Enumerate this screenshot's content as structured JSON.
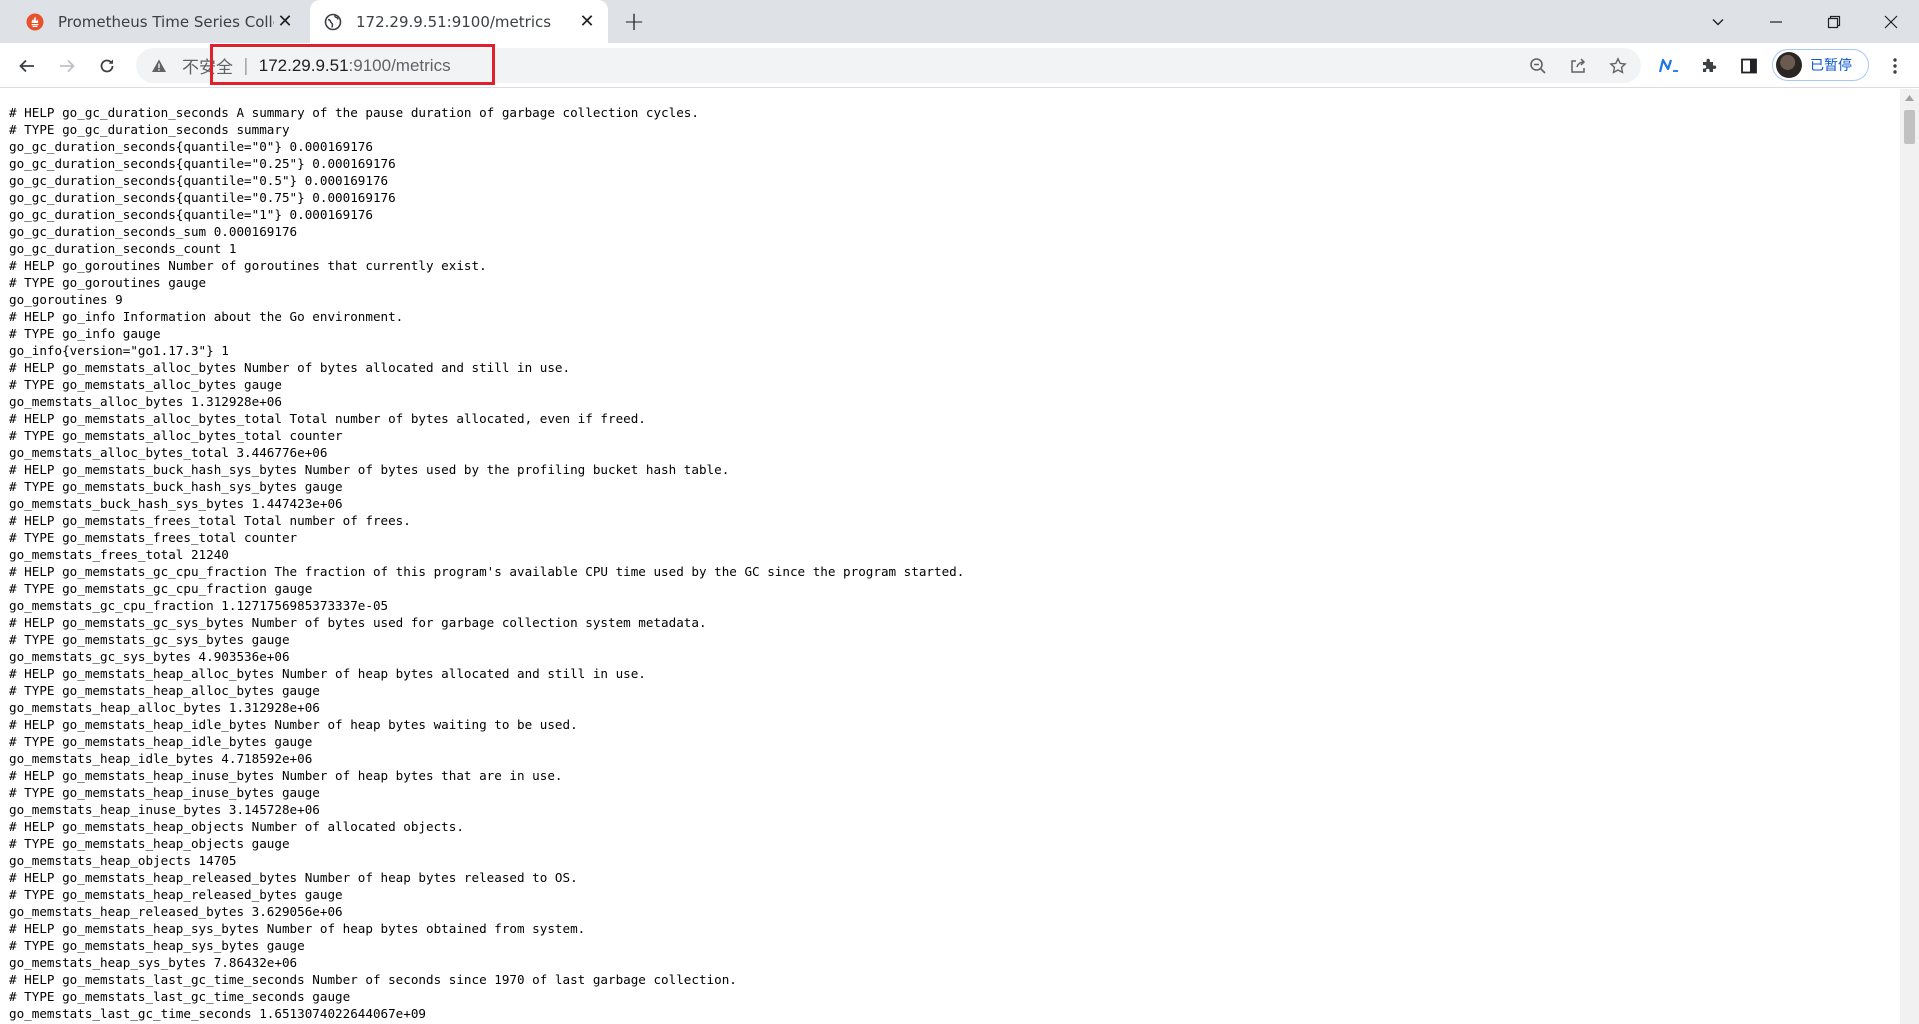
{
  "tabs": [
    {
      "title": "Prometheus Time Series Collection",
      "favicon": "prometheus-icon",
      "active": false
    },
    {
      "title": "172.29.9.51:9100/metrics",
      "favicon": "globe-icon",
      "active": true
    }
  ],
  "toolbar": {
    "security_label": "不安全",
    "separator": "|",
    "url_host": "172.29.9.51",
    "url_rest": ":9100/metrics",
    "profile_label": "已暂停"
  },
  "icons": {
    "back": "back-arrow-icon",
    "forward": "forward-arrow-icon",
    "reload": "reload-icon",
    "zoom": "zoom-out-icon",
    "share": "share-icon",
    "bookmark": "star-icon",
    "extension_n": "extension-n-icon",
    "extensions": "puzzle-icon",
    "side_panel": "side-panel-icon",
    "menu": "kebab-menu-icon"
  },
  "metrics_lines": [
    "# HELP go_gc_duration_seconds A summary of the pause duration of garbage collection cycles.",
    "# TYPE go_gc_duration_seconds summary",
    "go_gc_duration_seconds{quantile=\"0\"} 0.000169176",
    "go_gc_duration_seconds{quantile=\"0.25\"} 0.000169176",
    "go_gc_duration_seconds{quantile=\"0.5\"} 0.000169176",
    "go_gc_duration_seconds{quantile=\"0.75\"} 0.000169176",
    "go_gc_duration_seconds{quantile=\"1\"} 0.000169176",
    "go_gc_duration_seconds_sum 0.000169176",
    "go_gc_duration_seconds_count 1",
    "# HELP go_goroutines Number of goroutines that currently exist.",
    "# TYPE go_goroutines gauge",
    "go_goroutines 9",
    "# HELP go_info Information about the Go environment.",
    "# TYPE go_info gauge",
    "go_info{version=\"go1.17.3\"} 1",
    "# HELP go_memstats_alloc_bytes Number of bytes allocated and still in use.",
    "# TYPE go_memstats_alloc_bytes gauge",
    "go_memstats_alloc_bytes 1.312928e+06",
    "# HELP go_memstats_alloc_bytes_total Total number of bytes allocated, even if freed.",
    "# TYPE go_memstats_alloc_bytes_total counter",
    "go_memstats_alloc_bytes_total 3.446776e+06",
    "# HELP go_memstats_buck_hash_sys_bytes Number of bytes used by the profiling bucket hash table.",
    "# TYPE go_memstats_buck_hash_sys_bytes gauge",
    "go_memstats_buck_hash_sys_bytes 1.447423e+06",
    "# HELP go_memstats_frees_total Total number of frees.",
    "# TYPE go_memstats_frees_total counter",
    "go_memstats_frees_total 21240",
    "# HELP go_memstats_gc_cpu_fraction The fraction of this program's available CPU time used by the GC since the program started.",
    "# TYPE go_memstats_gc_cpu_fraction gauge",
    "go_memstats_gc_cpu_fraction 1.1271756985373337e-05",
    "# HELP go_memstats_gc_sys_bytes Number of bytes used for garbage collection system metadata.",
    "# TYPE go_memstats_gc_sys_bytes gauge",
    "go_memstats_gc_sys_bytes 4.903536e+06",
    "# HELP go_memstats_heap_alloc_bytes Number of heap bytes allocated and still in use.",
    "# TYPE go_memstats_heap_alloc_bytes gauge",
    "go_memstats_heap_alloc_bytes 1.312928e+06",
    "# HELP go_memstats_heap_idle_bytes Number of heap bytes waiting to be used.",
    "# TYPE go_memstats_heap_idle_bytes gauge",
    "go_memstats_heap_idle_bytes 4.718592e+06",
    "# HELP go_memstats_heap_inuse_bytes Number of heap bytes that are in use.",
    "# TYPE go_memstats_heap_inuse_bytes gauge",
    "go_memstats_heap_inuse_bytes 3.145728e+06",
    "# HELP go_memstats_heap_objects Number of allocated objects.",
    "# TYPE go_memstats_heap_objects gauge",
    "go_memstats_heap_objects 14705",
    "# HELP go_memstats_heap_released_bytes Number of heap bytes released to OS.",
    "# TYPE go_memstats_heap_released_bytes gauge",
    "go_memstats_heap_released_bytes 3.629056e+06",
    "# HELP go_memstats_heap_sys_bytes Number of heap bytes obtained from system.",
    "# TYPE go_memstats_heap_sys_bytes gauge",
    "go_memstats_heap_sys_bytes 7.86432e+06",
    "# HELP go_memstats_last_gc_time_seconds Number of seconds since 1970 of last garbage collection.",
    "# TYPE go_memstats_last_gc_time_seconds gauge",
    "go_memstats_last_gc_time_seconds 1.6513074022644067e+09"
  ],
  "colors": {
    "tabstrip": "#dee1e6",
    "highlight": "#e0202a",
    "prometheus": "#e6522c"
  }
}
